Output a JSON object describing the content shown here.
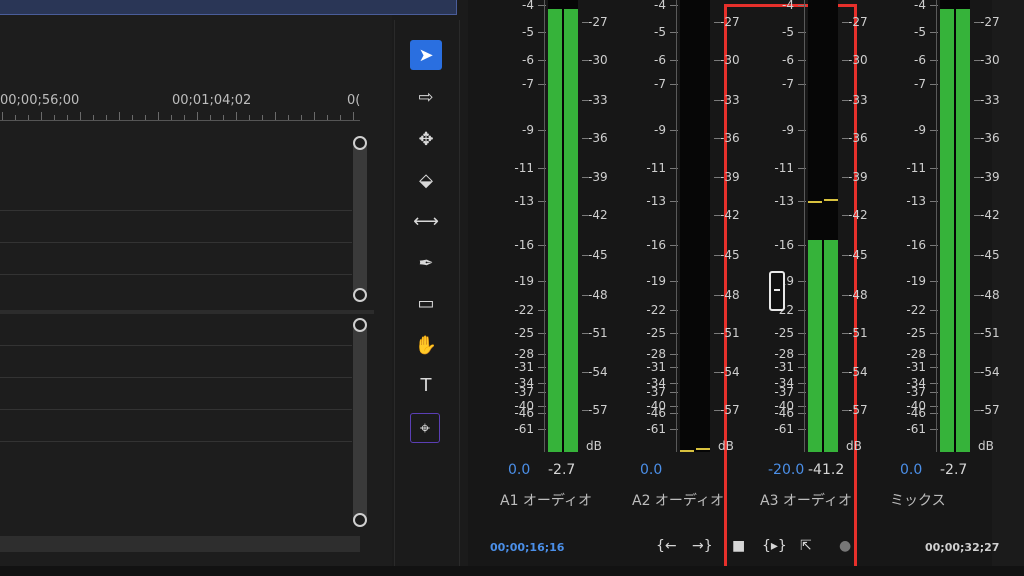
{
  "timeline": {
    "timecodes": [
      "00;00;56;00",
      "00;01;04;02",
      "0("
    ]
  },
  "tools": [
    {
      "name": "selection-tool",
      "glyph": "➤"
    },
    {
      "name": "track-select-tool",
      "glyph": "⇨"
    },
    {
      "name": "ripple-edit-tool",
      "glyph": "✥"
    },
    {
      "name": "razor-tool",
      "glyph": "⬙"
    },
    {
      "name": "slip-tool",
      "glyph": "⟷"
    },
    {
      "name": "pen-tool",
      "glyph": "✒"
    },
    {
      "name": "rectangle-tool",
      "glyph": "▭"
    },
    {
      "name": "hand-tool",
      "glyph": "✋"
    },
    {
      "name": "type-tool",
      "glyph": "T"
    },
    {
      "name": "remix-tool",
      "glyph": "⌖"
    }
  ],
  "meters": {
    "left_scale": [
      "-4",
      "-5",
      "-6",
      "-7",
      "-9",
      "-11",
      "-13",
      "-16",
      "-19",
      "-22",
      "-25",
      "-28",
      "-31",
      "-34",
      "-37",
      "-40",
      "-46",
      "-61"
    ],
    "right_scale": [
      "-27",
      "-30",
      "-33",
      "-36",
      "-39",
      "-42",
      "-45",
      "-48",
      "-51",
      "-54",
      "-57"
    ],
    "db_label": "dB",
    "channels": [
      {
        "id": "A1",
        "label": "A1",
        "name": "オーディオ",
        "pan": "0.0",
        "level": "-2.7",
        "fill": 0.98,
        "peak": null
      },
      {
        "id": "A2",
        "label": "A2",
        "name": "オーディオ",
        "pan": "0.0",
        "level": "",
        "fill": 0.0,
        "peak": 0.0
      },
      {
        "id": "A3",
        "label": "A3",
        "name": "オーディオ",
        "pan": "-20.0",
        "level": "-41.2",
        "fill": 0.47,
        "peak": 0.55
      },
      {
        "id": "MIX",
        "label": "",
        "name": "ミックス",
        "pan": "0.0",
        "level": "-2.7",
        "fill": 0.98,
        "peak": null
      }
    ],
    "timecode_in": "00;00;16;16",
    "timecode_out": "00;00;32;27",
    "controls": [
      "go-to-in-icon",
      "go-to-out-icon",
      "stop-icon",
      "loop-in-out-icon",
      "export-icon",
      "record-icon"
    ],
    "control_glyphs": [
      "{←",
      "→}",
      "■",
      "{▸}",
      "⇱",
      "●"
    ]
  },
  "colors": {
    "meter_green": "#36b33a",
    "highlight": "#e7302b",
    "accent_blue": "#2a6fe0",
    "pan_blue": "#4b8fe8",
    "peak_yellow": "#d8c13e"
  }
}
